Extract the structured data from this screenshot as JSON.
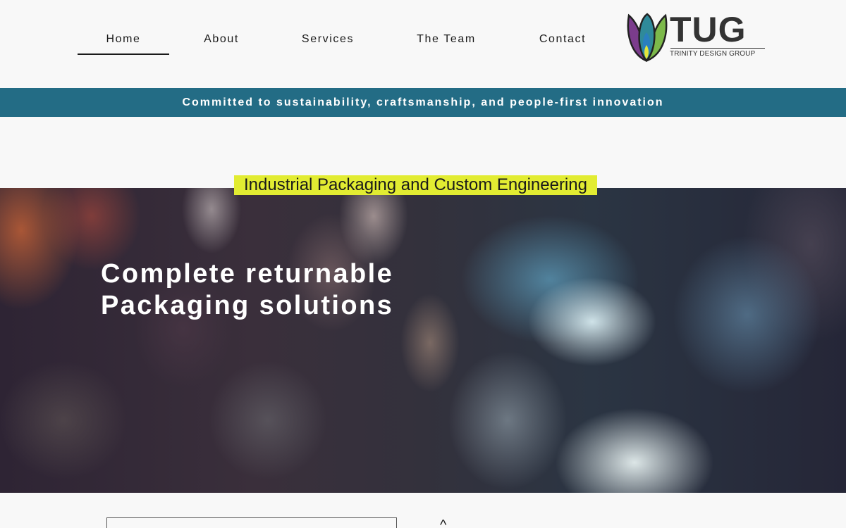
{
  "nav": {
    "items": [
      {
        "label": "Home",
        "active": true
      },
      {
        "label": "About",
        "active": false
      },
      {
        "label": "Services",
        "active": false
      },
      {
        "label": "The Team",
        "active": false
      },
      {
        "label": "Contact",
        "active": false
      }
    ]
  },
  "logo": {
    "wordmark": "TUG",
    "subtitle": "TRINITY DESIGN GROUP",
    "colors": {
      "purple": "#7b3c8c",
      "teal": "#2f8a9a",
      "blue": "#2a7fc0",
      "green": "#7cb94a",
      "yellow": "#e4e63a"
    }
  },
  "banner": {
    "text": "Committed to sustainability, craftsmanship, and people-first innovation",
    "color": "#236c85"
  },
  "tag": {
    "text": "Industrial Packaging and Custom Engineering",
    "color": "#e2ec32"
  },
  "hero": {
    "line1": "Complete returnable",
    "line2": "Packaging solutions"
  },
  "below": {
    "caret": "^"
  }
}
